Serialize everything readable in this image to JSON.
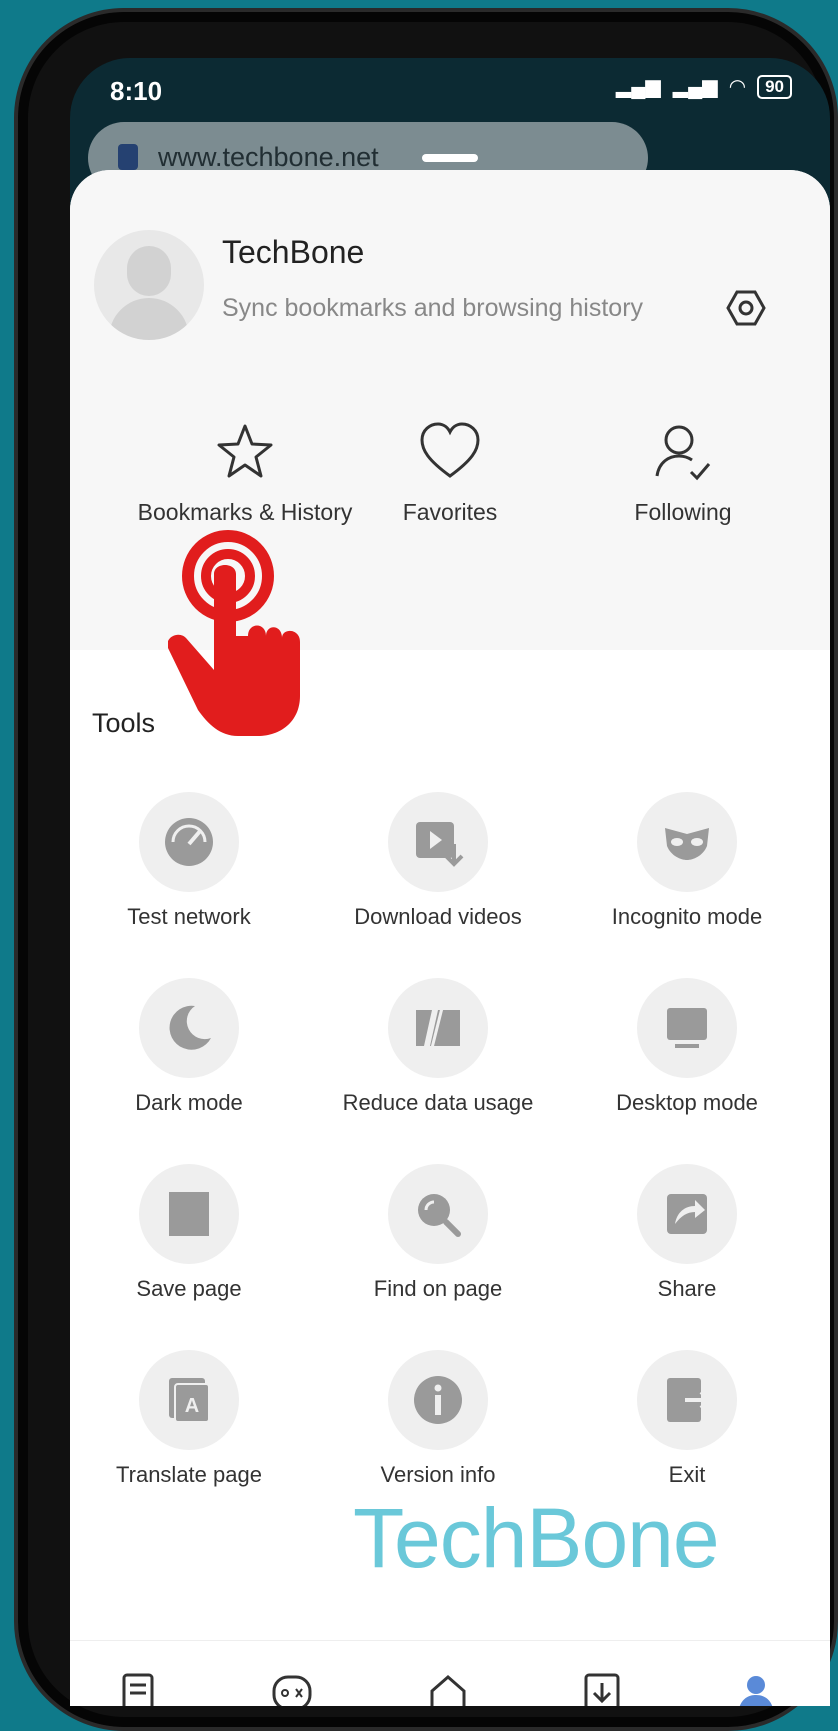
{
  "status": {
    "time": "8:10",
    "battery": "90"
  },
  "browser": {
    "url": "www.techbone.net"
  },
  "profile": {
    "name": "TechBone",
    "subtitle": "Sync bookmarks and browsing history"
  },
  "quick_actions": [
    {
      "label": "Bookmarks & History",
      "icon": "star-icon"
    },
    {
      "label": "Favorites",
      "icon": "heart-icon"
    },
    {
      "label": "Following",
      "icon": "user-check-icon"
    }
  ],
  "tools_title": "Tools",
  "tools": [
    {
      "label": "Test network",
      "icon": "speedometer-icon"
    },
    {
      "label": "Download videos",
      "icon": "video-download-icon"
    },
    {
      "label": "Incognito mode",
      "icon": "mask-icon"
    },
    {
      "label": "Dark mode",
      "icon": "moon-icon"
    },
    {
      "label": "Reduce data usage",
      "icon": "data-saver-icon"
    },
    {
      "label": "Desktop mode",
      "icon": "monitor-icon"
    },
    {
      "label": "Save page",
      "icon": "save-page-icon"
    },
    {
      "label": "Find on page",
      "icon": "find-icon"
    },
    {
      "label": "Share",
      "icon": "share-icon"
    },
    {
      "label": "Translate page",
      "icon": "translate-icon"
    },
    {
      "label": "Version info",
      "icon": "info-icon"
    },
    {
      "label": "Exit",
      "icon": "exit-icon"
    }
  ],
  "watermark": "TechBone",
  "colors": {
    "accent": "#e11d1d",
    "background": "#0f7a8a",
    "icon_gray": "#9a9a9a"
  }
}
